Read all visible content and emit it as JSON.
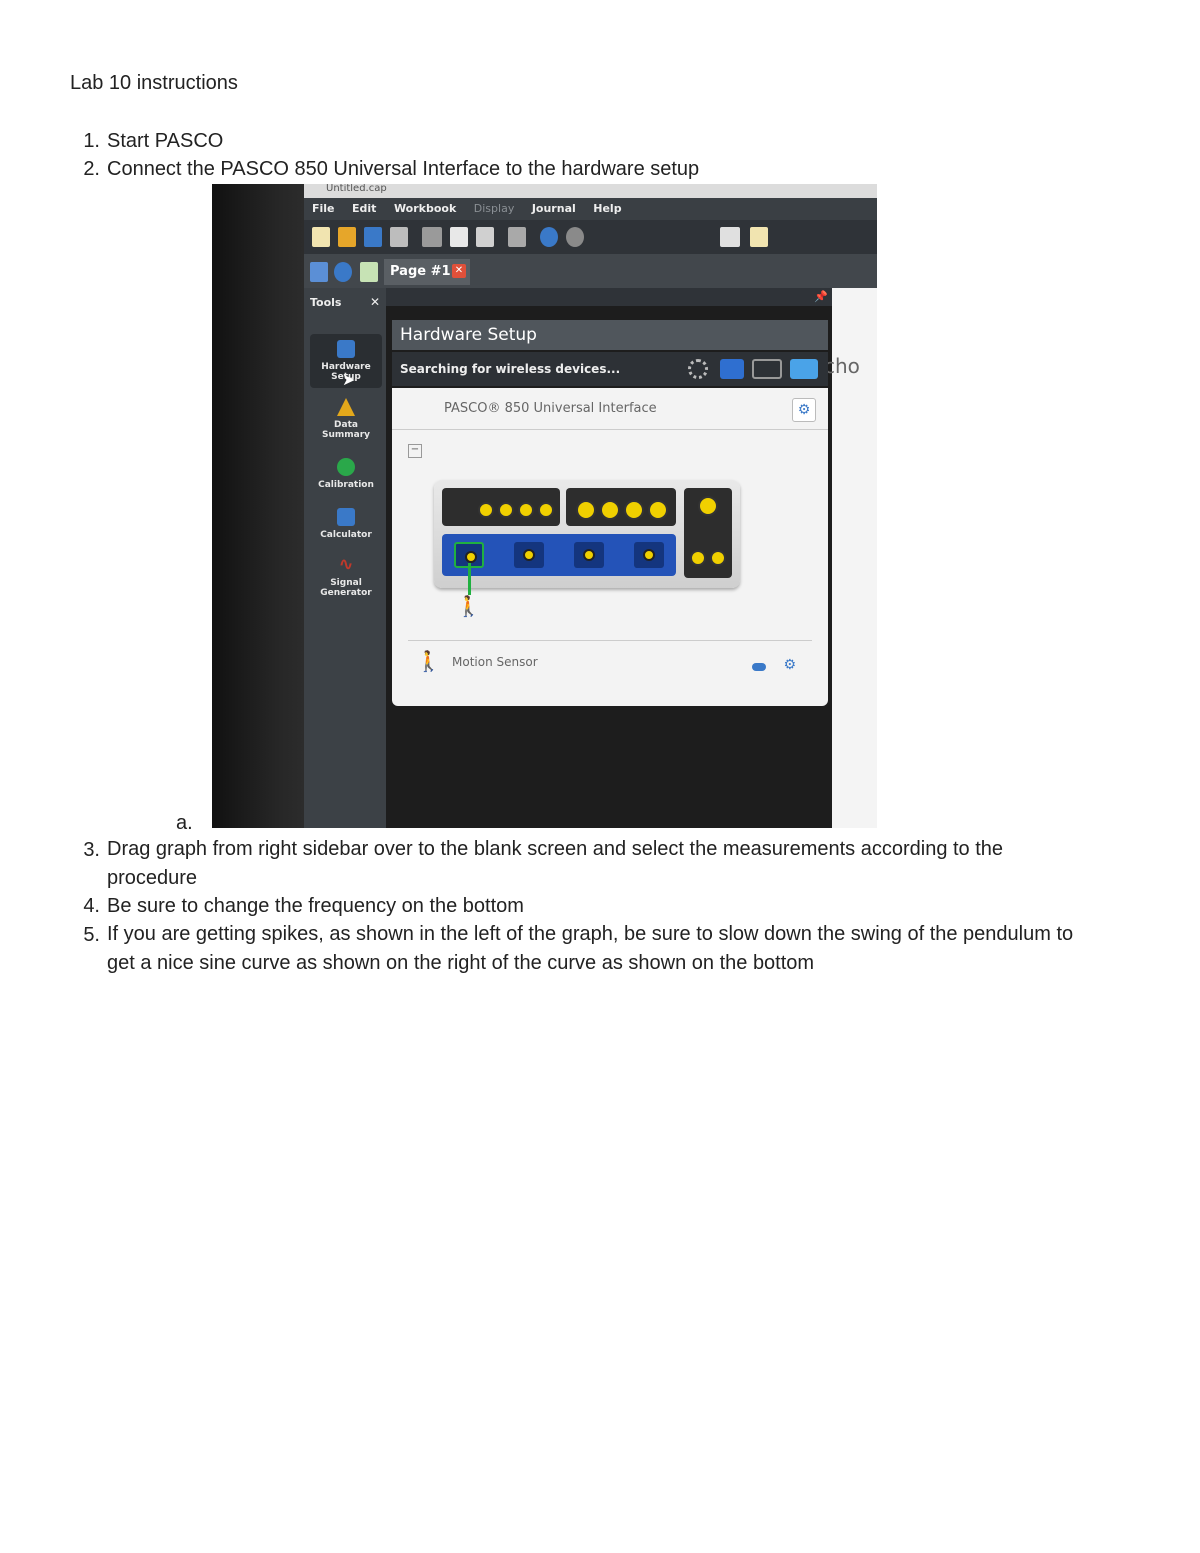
{
  "document": {
    "title": "Lab 10 instructions",
    "steps": [
      {
        "number": "1.",
        "text": "Start PASCO"
      },
      {
        "number": "2.",
        "text": "Connect the PASCO 850 Universal Interface to the hardware setup"
      },
      {
        "number": "3.",
        "text": "Drag graph from right sidebar over to the blank screen and select the measurements according to the procedure"
      },
      {
        "number": "4.",
        "text": "Be sure to change the frequency on the bottom"
      },
      {
        "number": "5.",
        "text": "If you are getting spikes, as shown in the left of the graph, be sure to slow down the swing of the pendulum to get a nice sine curve as shown on the right of the curve as shown on the bottom"
      }
    ],
    "sub_item_marker": "a."
  },
  "screenshot": {
    "window_title": "Untitled.cap",
    "menu": [
      "File",
      "Edit",
      "Workbook",
      "Display",
      "Journal",
      "Help"
    ],
    "tab_label": "Page #1",
    "tools_header": "Tools",
    "tools": [
      {
        "label": "Hardware Setup",
        "icon": "hardware-icon",
        "color": "#3a79c8"
      },
      {
        "label": "Data Summary",
        "icon": "data-summary-icon",
        "color": "#e3a81b"
      },
      {
        "label": "Calibration",
        "icon": "calibration-icon",
        "color": "#2aa84a"
      },
      {
        "label": "Calculator",
        "icon": "calculator-icon",
        "color": "#3a79c8"
      },
      {
        "label": "Signal Generator",
        "icon": "signal-generator-icon",
        "color": "#c0392b"
      }
    ],
    "panel_title": "Hardware Setup",
    "search_status": "Searching for wireless devices...",
    "interface_name": "PASCO® 850 Universal Interface",
    "sensor_name": "Motion Sensor",
    "background_text": "cho"
  }
}
